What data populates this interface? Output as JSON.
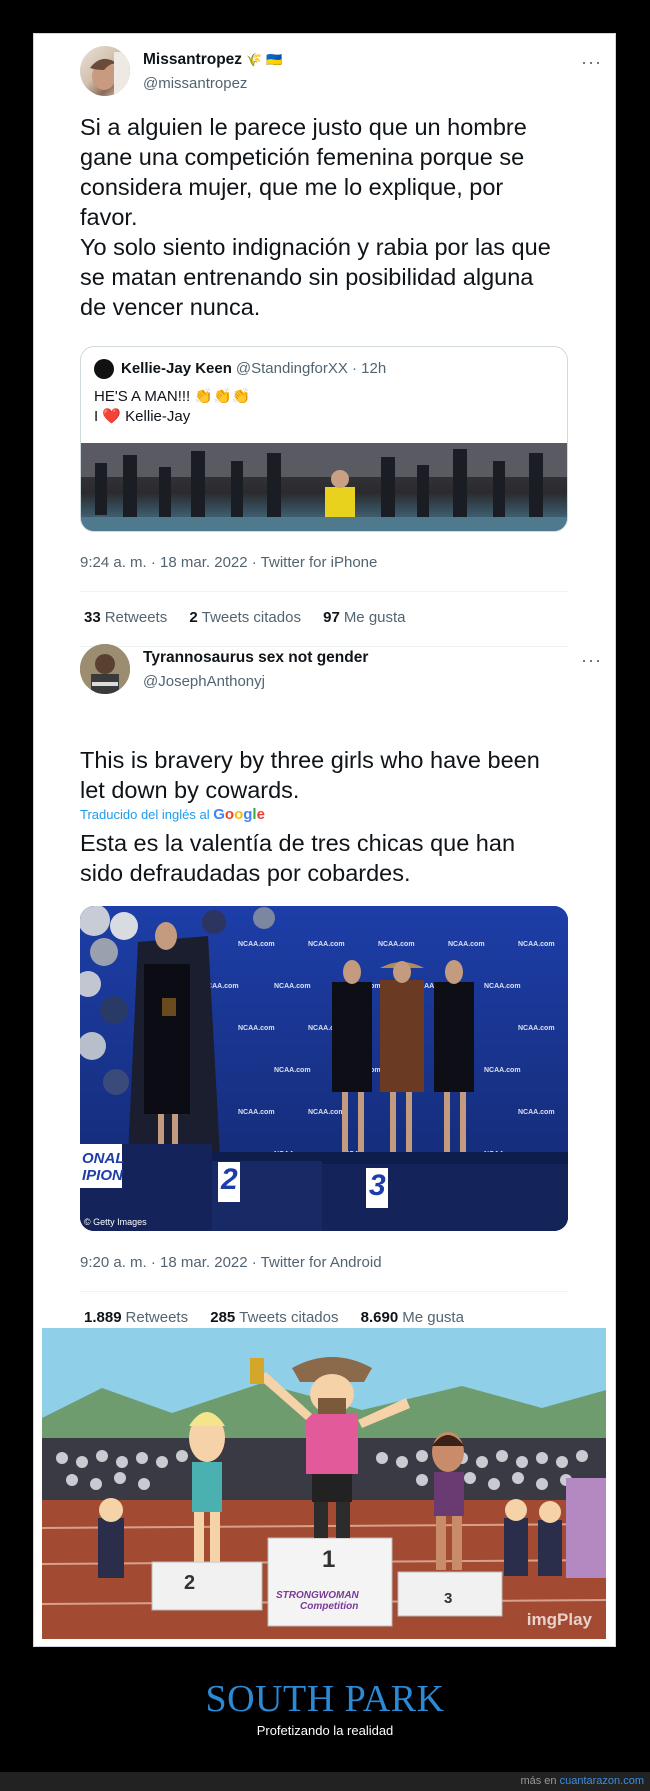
{
  "tweet1": {
    "display_name": "Missantropez",
    "name_emoji": "🌾 🇺🇦",
    "handle": "@missantropez",
    "more": "···",
    "text": "Si a alguien le parece justo que un hombre\ngane una competición femenina porque se\nconsidera mujer, que me lo explique, por\nfavor.\nYo solo siento indignación y rabia por las que\nse matan entrenando sin posibilidad alguna\nde vencer nunca.",
    "quote": {
      "name": "Kellie-Jay Keen",
      "handle_time": "@StandingforXX · 12h",
      "line1": "HE'S A MAN!!! 👏👏👏",
      "line2": "I ❤️ Kellie-Jay"
    },
    "meta": "9:24 a. m. · 18 mar. 2022 · Twitter for iPhone",
    "stats": {
      "retweets_count": "33",
      "retweets_label": "Retweets",
      "quotes_count": "2",
      "quotes_label": "Tweets citados",
      "likes_count": "97",
      "likes_label": "Me gusta"
    }
  },
  "tweet2": {
    "display_name": "Tyrannosaurus sex not gender",
    "handle": "@JosephAnthonyj",
    "more": "···",
    "text": "This is bravery by three girls who have been\nlet down by cowards.",
    "translated_prefix": "Traducido del inglés al",
    "google": "Google",
    "translated_text": "Esta es la valentía de tres chicas que han\nsido defraudadas por cobardes.",
    "photo": {
      "banner1": "ONAL",
      "banner2": "IPION",
      "place2": "2",
      "place3": "3",
      "credit": "© Getty Images",
      "logo": "NCAA.com"
    },
    "meta": "9:20 a. m. · 18 mar. 2022 · Twitter for Android",
    "stats": {
      "retweets_count": "1.889",
      "retweets_label": "Retweets",
      "quotes_count": "285",
      "quotes_label": "Tweets citados",
      "likes_count": "8.690",
      "likes_label": "Me gusta"
    }
  },
  "cartoon": {
    "place1": "1",
    "place2": "2",
    "place3": "3",
    "podium_sign": "STRONGWOMAN",
    "podium_sign2": "Competition",
    "watermark": "imgPlay"
  },
  "footer": {
    "title": "SOUTH PARK",
    "subtitle": "Profetizando la realidad",
    "more_prefix": "más en",
    "site": "cuantarazon.com"
  }
}
